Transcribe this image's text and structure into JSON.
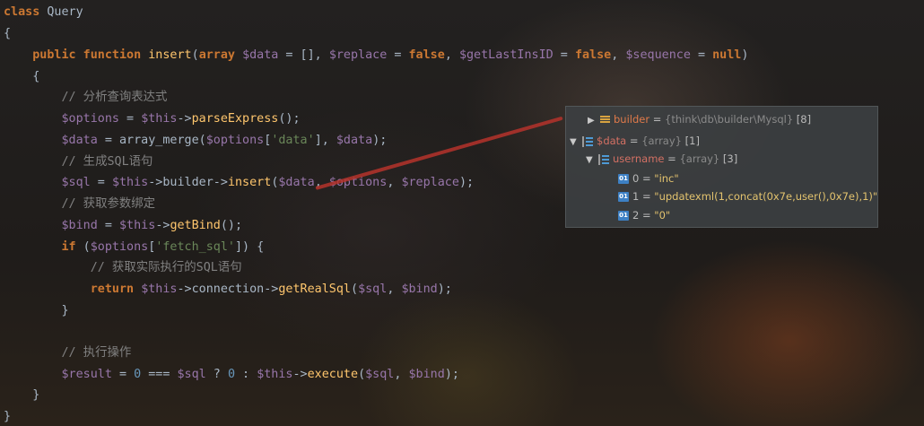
{
  "code": [
    "class Query",
    "{",
    "    public function insert(array $data = [], $replace = false, $getLastInsID = false, $sequence = null)",
    "    {",
    "        // 分析查询表达式",
    "        $options = $this->parseExpress();",
    "        $data = array_merge($options['data'], $data);",
    "        // 生成SQL语句",
    "        $sql = $this->builder->insert($data, $options, $replace);",
    "        // 获取参数绑定",
    "        $bind = $this->getBind();",
    "        if ($options['fetch_sql']) {",
    "            // 获取实际执行的SQL语句",
    "            return $this->connection->getRealSql($sql, $bind);",
    "        }",
    "",
    "        // 执行操作",
    "        $result = 0 === $sql ? 0 : $this->execute($sql, $bind);",
    "    }",
    "}"
  ],
  "debugger": {
    "builder": {
      "name": "builder",
      "eq": " = ",
      "type": "{think\\db\\builder\\Mysql}",
      "count": " [8]"
    },
    "data": {
      "name": "$data",
      "eq": " = ",
      "type": "{array}",
      "count": " [1]"
    },
    "username": {
      "name": "username",
      "eq": " = ",
      "type": "{array}",
      "count": " [3]"
    },
    "items": [
      {
        "index": "0",
        "eq": " = ",
        "value": "\"inc\""
      },
      {
        "index": "1",
        "eq": " = ",
        "value": "\"updatexml(1,concat(0x7e,user(),0x7e),1)\""
      },
      {
        "index": "2",
        "eq": " = ",
        "value": "\"0\""
      }
    ],
    "icon_label": "01"
  },
  "colors": {
    "keyword": "#cc7832",
    "variable": "#9876aa",
    "function": "#ffc66d",
    "comment": "#808080",
    "string": "#6a8759",
    "number": "#6897bb",
    "pointer": "#b5332b"
  }
}
